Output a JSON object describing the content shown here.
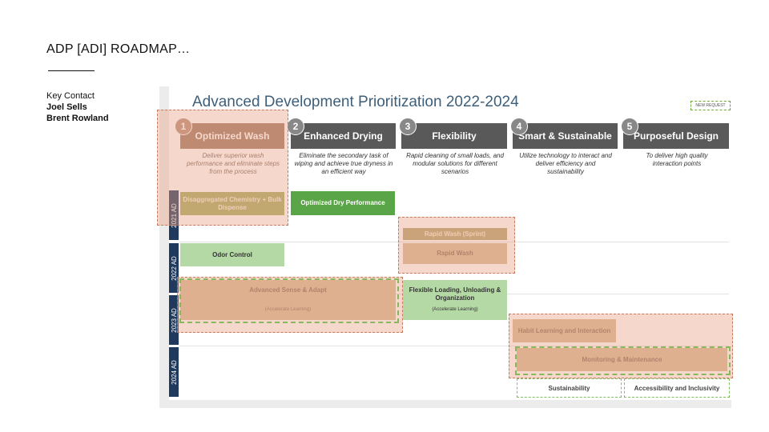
{
  "slide": {
    "title": "ADP [ADI] ROADMAP…",
    "contact_label": "Key Contact",
    "contacts": [
      "Joel Sells",
      "Brent Rowland"
    ]
  },
  "roadmap": {
    "title": "Advanced Development Prioritization 2022-2024",
    "badge": "NEW REQUEST",
    "pillars": [
      {
        "num": "1",
        "name": "Optimized Wash",
        "desc": "Deliver superior wash performance and eliminate steps from the process"
      },
      {
        "num": "2",
        "name": "Enhanced Drying",
        "desc": "Eliminate the secondary task of wiping and achieve true dryness in an efficient way"
      },
      {
        "num": "3",
        "name": "Flexibility",
        "desc": "Rapid cleaning of small loads, and modular solutions for different scenarios"
      },
      {
        "num": "4",
        "name": "Smart & Sustainable",
        "desc": "Utilize technology to interact and deliver efficiency and sustainability"
      },
      {
        "num": "5",
        "name": "Purposeful Design",
        "desc": "To deliver high quality interaction points"
      }
    ],
    "years": [
      "2021 AD",
      "2022 AD",
      "2023 AD",
      "2024 AD"
    ],
    "items": {
      "chem": "Disaggregated Chemistry + Bulk Dispense",
      "dry": "Optimized Dry Performance",
      "sprint": "Rapid Wash (Sprint)",
      "rapid": "Rapid Wash",
      "odor": "Odor Control",
      "sense": "Advanced Sense & Adapt",
      "sense_sub": "(Accelerate Learning)",
      "flex": "Flexible Loading, Unloading & Organization",
      "flex_sub": "(Accelerate Learning)",
      "habit": "Habit Learning and Interaction",
      "monitor": "Monitoring & Maintenance",
      "sustain": "Sustainability",
      "access": "Accessibility and Inclusivity"
    }
  }
}
